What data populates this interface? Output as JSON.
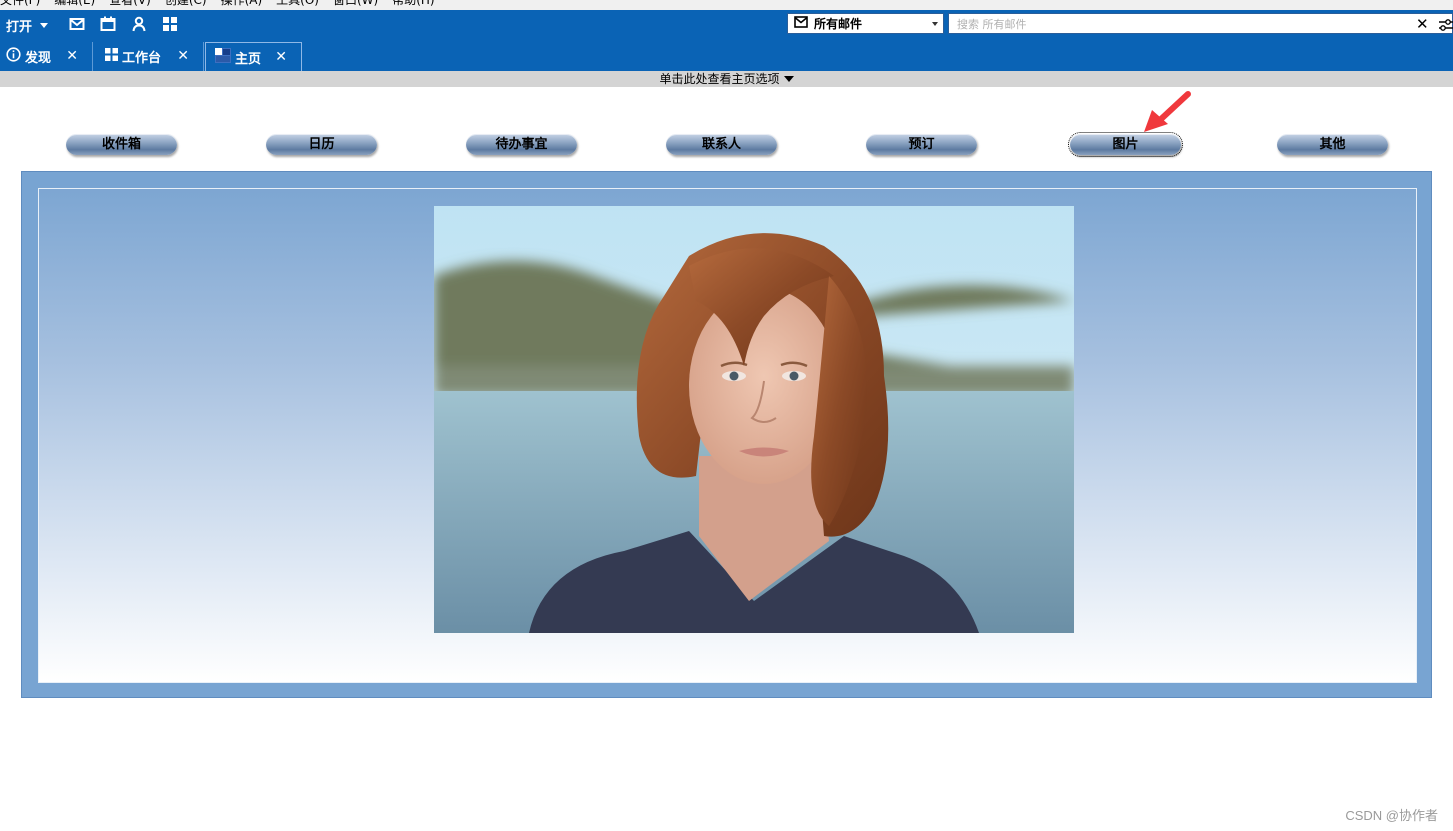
{
  "menubar": {
    "items": [
      "文件(F)",
      "编辑(E)",
      "查看(V)",
      "创建(C)",
      "操作(A)",
      "工具(O)",
      "窗口(W)",
      "帮助(H)"
    ]
  },
  "toolbar": {
    "open_label": "打开",
    "icons": [
      "mail-icon",
      "calendar-icon",
      "contact-icon",
      "grid-icon"
    ],
    "folder_select": "所有邮件",
    "search_placeholder": "搜索 所有邮件"
  },
  "tabs": [
    {
      "label": "发现",
      "icon": "info-icon",
      "active": false
    },
    {
      "label": "工作台",
      "icon": "grid-icon",
      "active": false
    },
    {
      "label": "主页",
      "icon": "home-page-icon",
      "active": true
    }
  ],
  "options_bar": {
    "label": "单击此处查看主页选项"
  },
  "nav_buttons": [
    {
      "label": "收件箱"
    },
    {
      "label": "日历"
    },
    {
      "label": "待办事宜"
    },
    {
      "label": "联系人"
    },
    {
      "label": "预订"
    },
    {
      "label": "图片",
      "focused": true
    },
    {
      "label": "其他"
    }
  ],
  "annotation": {
    "color": "#f0383c",
    "points_to": "图片"
  },
  "main_panel": {
    "image": "portrait-photo"
  },
  "watermark": "CSDN @协作者",
  "colors": {
    "toolbar_blue": "#0a63b5",
    "panel_blue": "#78a4d2",
    "options_bar_gray": "#d4d4d4"
  }
}
